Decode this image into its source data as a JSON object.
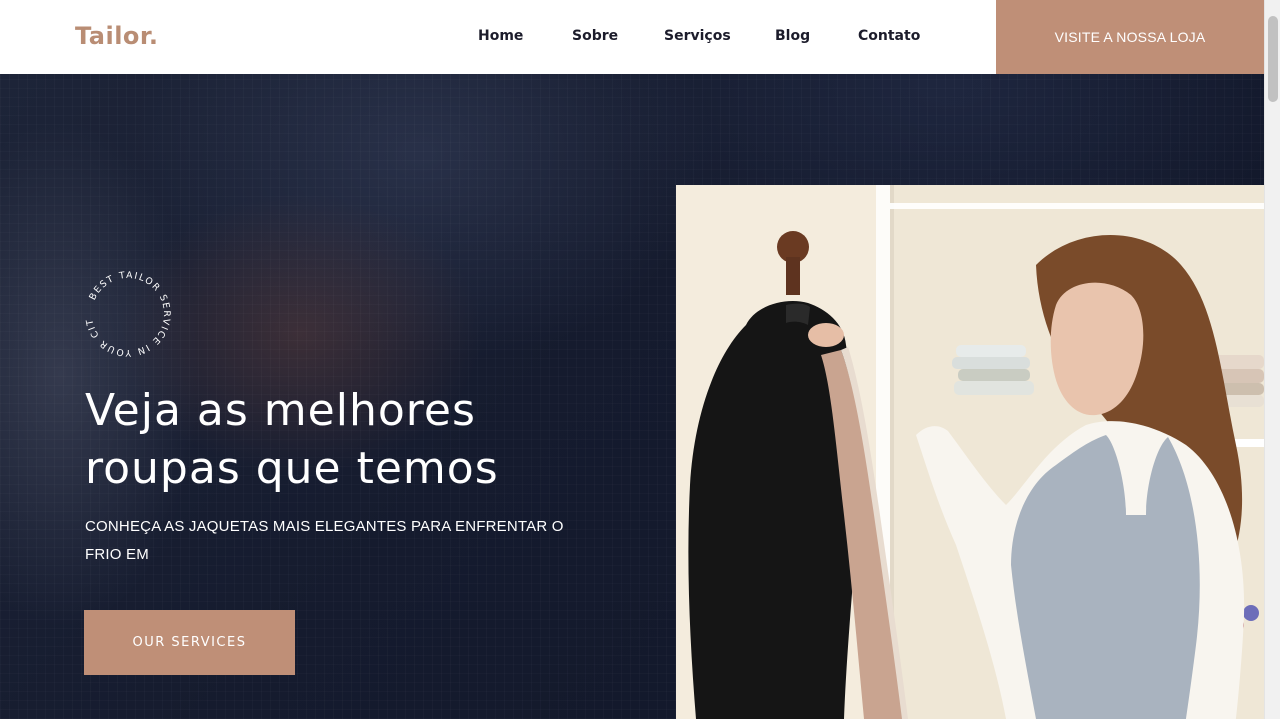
{
  "header": {
    "logo": "Tailor.",
    "nav": [
      "Home",
      "Sobre",
      "Serviços",
      "Blog",
      "Contato"
    ],
    "shop_button": "VISITE A NOSSA LOJA"
  },
  "hero": {
    "badge_text": "BEST TAILOR SERVICE IN YOUR CITY",
    "title_line1": "Veja as melhores",
    "title_line2": "roupas que temos",
    "subtitle": "CONHEÇA AS JAQUETAS MAIS ELEGANTES PARA ENFRENTAR O FRIO EM",
    "cta_button": "OUR SERVICES"
  },
  "colors": {
    "accent": "#bf8f77",
    "logo": "#b98d74",
    "hero_bg": "#151b2e",
    "nav_text": "#1c1c2b"
  }
}
